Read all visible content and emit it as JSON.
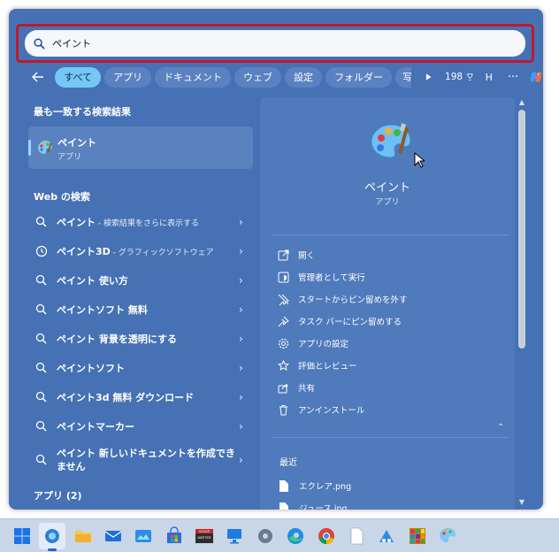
{
  "search": {
    "value": "ペイント",
    "icon": "search-icon"
  },
  "filters": {
    "tabs": [
      {
        "label": "すべて",
        "active": true
      },
      {
        "label": "アプリ"
      },
      {
        "label": "ドキュメント"
      },
      {
        "label": "ウェブ"
      },
      {
        "label": "設定"
      },
      {
        "label": "フォルダー"
      },
      {
        "label": "写"
      }
    ],
    "points": "198",
    "profile_initial": "H",
    "more": "···"
  },
  "best_match": {
    "heading": "最も一致する検索結果",
    "name": "ペイント",
    "type": "アプリ"
  },
  "web": {
    "heading": "Web の検索",
    "items": [
      {
        "main": "ペイント",
        "sub": " - 検索結果をさらに表示する",
        "icon": "search-icon"
      },
      {
        "main": "ペイント3D",
        "sub": " - グラフィックソフトウェア",
        "icon": "history-icon"
      },
      {
        "main": "ペイント 使い方",
        "sub": "",
        "icon": "search-icon"
      },
      {
        "main": "ペイントソフト 無料",
        "sub": "",
        "icon": "search-icon"
      },
      {
        "main": "ペイント 背景を透明にする",
        "sub": "",
        "icon": "search-icon"
      },
      {
        "main": "ペイントソフト",
        "sub": "",
        "icon": "search-icon"
      },
      {
        "main": "ペイント3d 無料 ダウンロード",
        "sub": "",
        "icon": "search-icon"
      },
      {
        "main": "ペイントマーカー",
        "sub": "",
        "icon": "search-icon"
      },
      {
        "main": "ペイント 新しいドキュメントを作成できません",
        "sub": "",
        "icon": "search-icon"
      }
    ]
  },
  "apps_heading": "アプリ (2)",
  "detail": {
    "title": "ペイント",
    "type": "アプリ",
    "actions": [
      {
        "label": "開く",
        "icon": "open-icon"
      },
      {
        "label": "管理者として実行",
        "icon": "shield-icon"
      },
      {
        "label": "スタートからピン留めを外す",
        "icon": "unpin-icon"
      },
      {
        "label": "タスク バーにピン留めする",
        "icon": "pin-icon"
      },
      {
        "label": "アプリの設定",
        "icon": "gear-icon"
      },
      {
        "label": "評価とレビュー",
        "icon": "star-icon"
      },
      {
        "label": "共有",
        "icon": "share-icon"
      },
      {
        "label": "アンインストール",
        "icon": "trash-icon"
      }
    ],
    "recent_heading": "最近",
    "recent": [
      {
        "label": "エクレア.png",
        "icon": "file-icon"
      },
      {
        "label": "ジュース.jpg",
        "icon": "file-icon"
      }
    ]
  },
  "taskbar": {
    "voice_label": "VOICE\nMEETER",
    "items": [
      "start-icon",
      "search-icon",
      "file-explorer-icon",
      "mail-icon",
      "photos-icon",
      "store-icon",
      "voicemeeter-icon",
      "monitor-icon",
      "settings-icon",
      "edge-icon",
      "chrome-icon",
      "notepad-icon",
      "snipping-icon",
      "grid-app-icon",
      "paint-icon"
    ]
  },
  "colors": {
    "panel": "#4671b4",
    "active_tab": "#75c7f6",
    "highlight_border": "#c0192b",
    "taskbar": "#c9d6e8"
  }
}
